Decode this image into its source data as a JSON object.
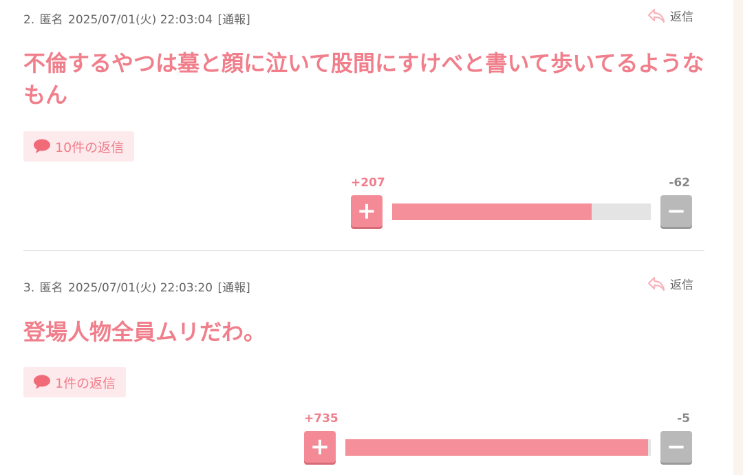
{
  "comments": [
    {
      "number": "2.",
      "author": "匿名",
      "datetime": "2025/07/01(火) 22:03:04",
      "report_label": "[通報]",
      "reply_label": "返信",
      "body": "不倫するやつは墓と顔に泣いて股間にすけべと書いて歩いてるようなもん",
      "reply_count_label": "10件の返信",
      "plus_label": "+207",
      "minus_label": "-62",
      "plus_votes": 207,
      "minus_votes": 62,
      "plus_ratio": 0.77
    },
    {
      "number": "3.",
      "author": "匿名",
      "datetime": "2025/07/01(火) 22:03:20",
      "report_label": "[通報]",
      "reply_label": "返信",
      "body": "登場人物全員ムリだわ。",
      "reply_count_label": "1件の返信",
      "plus_label": "+735",
      "minus_label": "-5",
      "plus_votes": 735,
      "minus_votes": 5,
      "plus_ratio": 0.99
    }
  ],
  "colors": {
    "accent": "#f07e8b",
    "plus_button": "#f38a96",
    "minus_button": "#b9b9b9",
    "bar_fill": "#f58f99",
    "bar_track": "#e4e4e4",
    "reply_pill_bg": "#fdeaec"
  },
  "icons": {
    "reply": "reply-arrow-icon",
    "bubble": "speech-bubble-icon",
    "plus": "plus-icon",
    "minus": "minus-icon"
  }
}
